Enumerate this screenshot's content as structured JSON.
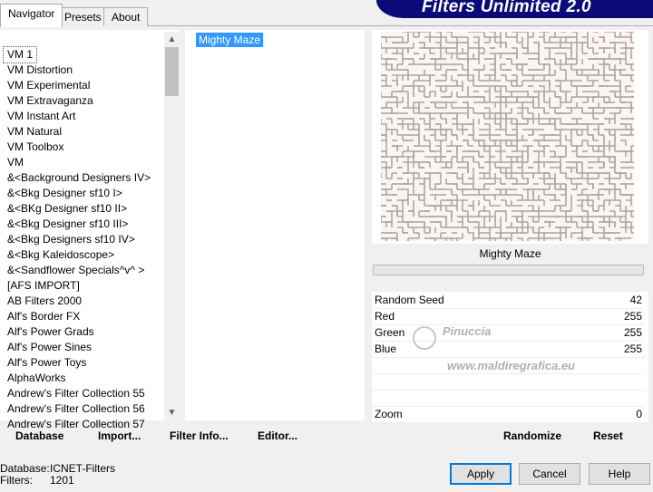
{
  "tabs": [
    "Navigator",
    "Presets",
    "About"
  ],
  "banner_title": "Filters Unlimited 2.0",
  "categories": [
    "VM 1",
    "VM Distortion",
    "VM Experimental",
    "VM Extravaganza",
    "VM Instant Art",
    "VM Natural",
    "VM Toolbox",
    "VM",
    "&<Background Designers IV>",
    "&<Bkg Designer sf10 I>",
    "&<BKg Designer sf10 II>",
    "&<Bkg Designer sf10 III>",
    "&<Bkg Designers sf10 IV>",
    "&<Bkg Kaleidoscope>",
    "&<Sandflower Specials^v^ >",
    "[AFS IMPORT]",
    "AB Filters 2000",
    "Alf's Border FX",
    "Alf's Power Grads",
    "Alf's Power Sines",
    "Alf's Power Toys",
    "AlphaWorks",
    "Andrew's Filter Collection 55",
    "Andrew's Filter Collection 56",
    "Andrew's Filter Collection 57"
  ],
  "selected_filter": "Mighty Maze",
  "preview_label": "Mighty Maze",
  "params": [
    {
      "label": "Random Seed",
      "value": "42"
    },
    {
      "label": "Red",
      "value": "255"
    },
    {
      "label": "Green",
      "value": "255"
    },
    {
      "label": "Blue",
      "value": "255"
    }
  ],
  "zoom": {
    "label": "Zoom",
    "value": "0"
  },
  "watermark": "Pinuccia\nwww.maldiregrafica.eu",
  "link_buttons": {
    "database": "Database",
    "import": "Import...",
    "filter_info": "Filter Info...",
    "editor": "Editor..."
  },
  "action_buttons": {
    "randomize": "Randomize",
    "reset": "Reset"
  },
  "dialog_buttons": {
    "apply": "Apply",
    "cancel": "Cancel",
    "help": "Help"
  },
  "status": {
    "database_label": "Database:",
    "database_value": "ICNET-Filters",
    "filters_label": "Filters:",
    "filters_value": "1201"
  },
  "colors": {
    "banner": "#0a0a78",
    "selection": "#3399ff",
    "maze": "#a9a9a9"
  }
}
